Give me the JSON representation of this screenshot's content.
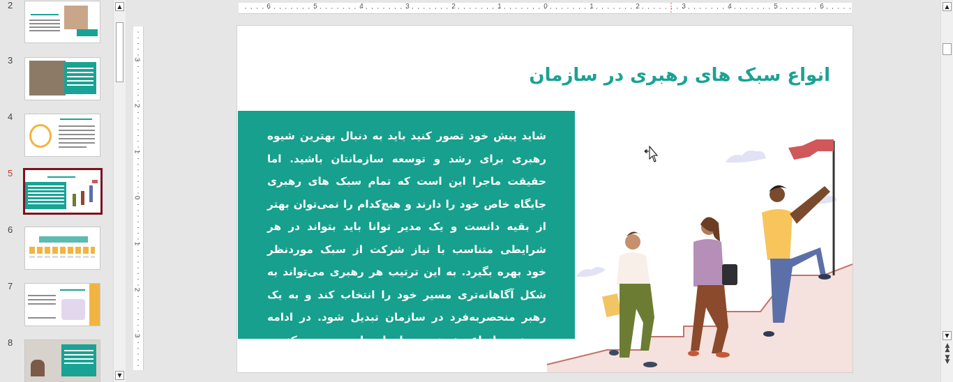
{
  "thumbnails": [
    {
      "number": "2"
    },
    {
      "number": "3"
    },
    {
      "number": "4"
    },
    {
      "number": "5",
      "active": true
    },
    {
      "number": "6"
    },
    {
      "number": "7"
    },
    {
      "number": "8"
    }
  ],
  "ruler": {
    "horizontal": [
      "6",
      "5",
      "4",
      "3",
      "2",
      "1",
      "0",
      "1",
      "2",
      "3",
      "4",
      "5",
      "6"
    ],
    "vertical": [
      "3",
      "2",
      "1",
      "0",
      "1",
      "2",
      "3"
    ]
  },
  "slide": {
    "title": "انواع سبک های رهبری در سازمان",
    "body": "شاید پیش خود تصور کنید باید به دنبال بهترین شیوه رهبری برای رشد و توسعه سازمانتان باشید. اما حقیقت ماجرا این است که تمام سبک های رهبری جایگاه خاص خود را دارند و هیچ‌کدام را نمی‌توان بهتر از بقیه دانست و یک مدیر توانا باید بتواند در هر شرایطی متناسب با نیاز شرکت از سبک موردنظر خود بهره بگیرد. به این ترتیب هر رهبری می‌تواند به شکل آگاهانه‌تری مسیر خود را انتخاب کند و به یک رهبر منحصربه‌فرد در سازمان تبدیل شود. در ادامه مهم‌ترین انواع رهبری در سازمان را بررسی می‌کنیم."
  },
  "colors": {
    "accent_teal": "#16a08d",
    "active_thumb_border": "#7b1120",
    "active_thumb_number": "#c43b1d"
  },
  "icons": {
    "scroll_up": "triangle-up",
    "scroll_down": "triangle-down",
    "prev_slide": "double-triangle-up",
    "next_slide": "double-triangle-down",
    "cursor": "move-cursor"
  }
}
